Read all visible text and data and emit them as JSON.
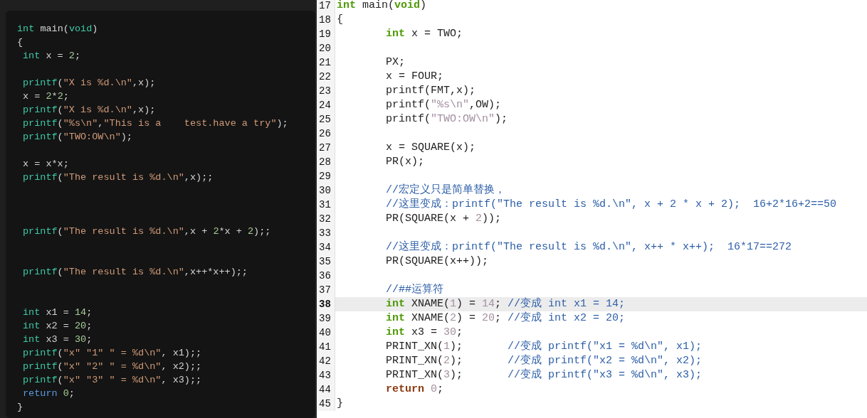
{
  "left_code": {
    "lines": [
      {
        "kind": "code",
        "segments": [
          {
            "text": "int",
            "kind": "keyword"
          },
          {
            "text": " main(",
            "kind": "plain"
          },
          {
            "text": "void",
            "kind": "keyword"
          },
          {
            "text": ")",
            "kind": "plain"
          }
        ]
      },
      {
        "kind": "code",
        "segments": [
          {
            "text": "{",
            "kind": "plain"
          }
        ],
        "children": [
          {
            "kind": "code",
            "segments": [
              {
                "text": "int",
                "kind": "keyword"
              },
              {
                "text": " x = ",
                "kind": "plain"
              },
              {
                "text": "2",
                "kind": "number"
              },
              {
                "text": ";",
                "kind": "plain"
              }
            ]
          },
          {
            "kind": "blank"
          },
          {
            "kind": "code",
            "segments": [
              {
                "text": "printf",
                "kind": "keyword"
              },
              {
                "text": "(",
                "kind": "plain"
              },
              {
                "text": "\"X is %d.\\n\"",
                "kind": "string"
              },
              {
                "text": ",x);",
                "kind": "plain"
              }
            ]
          },
          {
            "kind": "code",
            "segments": [
              {
                "text": "x = ",
                "kind": "plain"
              },
              {
                "text": "2",
                "kind": "number"
              },
              {
                "text": "*",
                "kind": "plain"
              },
              {
                "text": "2",
                "kind": "number"
              },
              {
                "text": ";",
                "kind": "plain"
              }
            ]
          },
          {
            "kind": "code",
            "segments": [
              {
                "text": "printf",
                "kind": "keyword"
              },
              {
                "text": "(",
                "kind": "plain"
              },
              {
                "text": "\"X is %d.\\n\"",
                "kind": "string"
              },
              {
                "text": ",x);",
                "kind": "plain"
              }
            ]
          },
          {
            "kind": "code",
            "segments": [
              {
                "text": "printf",
                "kind": "keyword"
              },
              {
                "text": "(",
                "kind": "plain"
              },
              {
                "text": "\"%s\\n\"",
                "kind": "string"
              },
              {
                "text": ",",
                "kind": "plain"
              },
              {
                "text": "\"This is a    test.have a try\"",
                "kind": "string"
              },
              {
                "text": ");",
                "kind": "plain"
              }
            ]
          },
          {
            "kind": "code",
            "segments": [
              {
                "text": "printf",
                "kind": "keyword"
              },
              {
                "text": "(",
                "kind": "plain"
              },
              {
                "text": "\"TWO:OW\\n\"",
                "kind": "string"
              },
              {
                "text": ");",
                "kind": "plain"
              }
            ]
          },
          {
            "kind": "blank"
          },
          {
            "kind": "code",
            "segments": [
              {
                "text": "x = x*x;",
                "kind": "plain"
              }
            ]
          },
          {
            "kind": "code",
            "segments": [
              {
                "text": "printf",
                "kind": "keyword"
              },
              {
                "text": "(",
                "kind": "plain"
              },
              {
                "text": "\"The result is %d.\\n\"",
                "kind": "string"
              },
              {
                "text": ",x);;",
                "kind": "plain"
              }
            ]
          },
          {
            "kind": "blank"
          },
          {
            "kind": "blank"
          },
          {
            "kind": "blank"
          },
          {
            "kind": "code",
            "segments": [
              {
                "text": "printf",
                "kind": "keyword"
              },
              {
                "text": "(",
                "kind": "plain"
              },
              {
                "text": "\"The result is %d.\\n\"",
                "kind": "string"
              },
              {
                "text": ",x + ",
                "kind": "plain"
              },
              {
                "text": "2",
                "kind": "number"
              },
              {
                "text": "*x + ",
                "kind": "plain"
              },
              {
                "text": "2",
                "kind": "number"
              },
              {
                "text": ");;",
                "kind": "plain"
              }
            ]
          },
          {
            "kind": "blank"
          },
          {
            "kind": "blank"
          },
          {
            "kind": "code",
            "segments": [
              {
                "text": "printf",
                "kind": "keyword"
              },
              {
                "text": "(",
                "kind": "plain"
              },
              {
                "text": "\"The result is %d.\\n\"",
                "kind": "string"
              },
              {
                "text": ",x++*x++);;",
                "kind": "plain"
              }
            ]
          },
          {
            "kind": "blank"
          },
          {
            "kind": "blank"
          },
          {
            "kind": "code",
            "segments": [
              {
                "text": "int",
                "kind": "keyword"
              },
              {
                "text": " x1 = ",
                "kind": "plain"
              },
              {
                "text": "14",
                "kind": "number"
              },
              {
                "text": ";",
                "kind": "plain"
              }
            ]
          },
          {
            "kind": "code",
            "segments": [
              {
                "text": "int",
                "kind": "keyword"
              },
              {
                "text": " x2 = ",
                "kind": "plain"
              },
              {
                "text": "20",
                "kind": "number"
              },
              {
                "text": ";",
                "kind": "plain"
              }
            ]
          },
          {
            "kind": "code",
            "segments": [
              {
                "text": "int",
                "kind": "keyword"
              },
              {
                "text": " x3 = ",
                "kind": "plain"
              },
              {
                "text": "30",
                "kind": "number"
              },
              {
                "text": ";",
                "kind": "plain"
              }
            ]
          },
          {
            "kind": "code",
            "segments": [
              {
                "text": "printf",
                "kind": "keyword"
              },
              {
                "text": "(",
                "kind": "plain"
              },
              {
                "text": "\"x\" \"1\" \" = %d\\n\"",
                "kind": "string"
              },
              {
                "text": ", x1);;",
                "kind": "plain"
              }
            ]
          },
          {
            "kind": "code",
            "segments": [
              {
                "text": "printf",
                "kind": "keyword"
              },
              {
                "text": "(",
                "kind": "plain"
              },
              {
                "text": "\"x\" \"2\" \" = %d\\n\"",
                "kind": "string"
              },
              {
                "text": ", x2);;",
                "kind": "plain"
              }
            ]
          },
          {
            "kind": "code",
            "segments": [
              {
                "text": "printf",
                "kind": "keyword"
              },
              {
                "text": "(",
                "kind": "plain"
              },
              {
                "text": "\"x\" \"3\" \" = %d\\n\"",
                "kind": "string"
              },
              {
                "text": ", x3);;",
                "kind": "plain"
              }
            ]
          },
          {
            "kind": "code",
            "segments": [
              {
                "text": "return ",
                "kind": "return"
              },
              {
                "text": "0",
                "kind": "number"
              },
              {
                "text": ";",
                "kind": "plain"
              }
            ]
          }
        ]
      },
      {
        "kind": "code",
        "segments": [
          {
            "text": "}",
            "kind": "plain"
          }
        ]
      }
    ]
  },
  "right_code": {
    "lines": [
      {
        "number": "17",
        "current": false,
        "segments": [
          {
            "text": "int",
            "kind": "keyword"
          },
          {
            "text": " main(",
            "kind": "plain"
          },
          {
            "text": "void",
            "kind": "keyword"
          },
          {
            "text": ")",
            "kind": "plain"
          }
        ]
      },
      {
        "number": "18",
        "current": false,
        "segments": [
          {
            "text": "{",
            "kind": "plain"
          }
        ],
        "children": [
          {
            "number": "19",
            "current": false,
            "segments": [
              {
                "text": "int",
                "kind": "keyword"
              },
              {
                "text": " x = TWO;",
                "kind": "plain"
              }
            ]
          },
          {
            "number": "20",
            "current": false
          },
          {
            "number": "21",
            "current": false,
            "segments": [
              {
                "text": "PX;",
                "kind": "plain"
              }
            ]
          },
          {
            "number": "22",
            "current": false,
            "segments": [
              {
                "text": "x = FOUR;",
                "kind": "plain"
              }
            ]
          },
          {
            "number": "23",
            "current": false,
            "segments": [
              {
                "text": "printf(FMT,x);",
                "kind": "plain"
              }
            ]
          },
          {
            "number": "24",
            "current": false,
            "segments": [
              {
                "text": "printf(",
                "kind": "plain"
              },
              {
                "text": "\"%s\\n\"",
                "kind": "string"
              },
              {
                "text": ",OW);",
                "kind": "plain"
              }
            ]
          },
          {
            "number": "25",
            "current": false,
            "segments": [
              {
                "text": "printf(",
                "kind": "plain"
              },
              {
                "text": "\"TWO:OW\\n\"",
                "kind": "string"
              },
              {
                "text": ");",
                "kind": "plain"
              }
            ]
          },
          {
            "number": "26",
            "current": false
          },
          {
            "number": "27",
            "current": false,
            "segments": [
              {
                "text": "x = SQUARE(x);",
                "kind": "plain"
              }
            ]
          },
          {
            "number": "28",
            "current": false,
            "segments": [
              {
                "text": "PR(x);",
                "kind": "plain"
              }
            ]
          },
          {
            "number": "29",
            "current": false
          },
          {
            "number": "30",
            "current": false,
            "segments": [
              {
                "text": "//宏定义只是简单替换，",
                "kind": "comment"
              }
            ]
          },
          {
            "number": "31",
            "current": false,
            "segments": [
              {
                "text": "//这里变成：printf(\"The result is %d.\\n\", x + 2 * x + 2);  16+2*16+2==50",
                "kind": "comment"
              }
            ]
          },
          {
            "number": "32",
            "current": false,
            "segments": [
              {
                "text": "PR(SQUARE(x + ",
                "kind": "plain"
              },
              {
                "text": "2",
                "kind": "number"
              },
              {
                "text": "));",
                "kind": "plain"
              }
            ]
          },
          {
            "number": "33",
            "current": false
          },
          {
            "number": "34",
            "current": false,
            "segments": [
              {
                "text": "//这里变成：printf(\"The result is %d.\\n\", x++ * x++);  16*17==272",
                "kind": "comment"
              }
            ]
          },
          {
            "number": "35",
            "current": false,
            "segments": [
              {
                "text": "PR(SQUARE(x++));",
                "kind": "plain"
              }
            ]
          },
          {
            "number": "36",
            "current": false
          },
          {
            "number": "37",
            "current": false,
            "segments": [
              {
                "text": "//##运算符",
                "kind": "comment"
              }
            ]
          },
          {
            "number": "38",
            "current": true,
            "segments": [
              {
                "text": "int",
                "kind": "keyword"
              },
              {
                "text": " XNAME(",
                "kind": "plain"
              },
              {
                "text": "1",
                "kind": "number"
              },
              {
                "text": ") = ",
                "kind": "plain"
              },
              {
                "text": "14",
                "kind": "number"
              },
              {
                "text": "; ",
                "kind": "plain"
              },
              {
                "text": "//变成 int x1 = 14;",
                "kind": "comment"
              }
            ]
          },
          {
            "number": "39",
            "current": false,
            "segments": [
              {
                "text": "int",
                "kind": "keyword"
              },
              {
                "text": " XNAME(",
                "kind": "plain"
              },
              {
                "text": "2",
                "kind": "number"
              },
              {
                "text": ") = ",
                "kind": "plain"
              },
              {
                "text": "20",
                "kind": "number"
              },
              {
                "text": "; ",
                "kind": "plain"
              },
              {
                "text": "//变成 int x2 = 20;",
                "kind": "comment"
              }
            ]
          },
          {
            "number": "40",
            "current": false,
            "segments": [
              {
                "text": "int",
                "kind": "keyword"
              },
              {
                "text": " x3 = ",
                "kind": "plain"
              },
              {
                "text": "30",
                "kind": "number"
              },
              {
                "text": ";",
                "kind": "plain"
              }
            ]
          },
          {
            "number": "41",
            "current": false,
            "segments": [
              {
                "text": "PRINT_XN(",
                "kind": "plain"
              },
              {
                "text": "1",
                "kind": "number"
              },
              {
                "text": ");       ",
                "kind": "plain"
              },
              {
                "text": "//变成 printf(\"x1 = %d\\n\", x1);",
                "kind": "comment"
              }
            ]
          },
          {
            "number": "42",
            "current": false,
            "segments": [
              {
                "text": "PRINT_XN(",
                "kind": "plain"
              },
              {
                "text": "2",
                "kind": "number"
              },
              {
                "text": ");       ",
                "kind": "plain"
              },
              {
                "text": "//变成 printf(\"x2 = %d\\n\", x2);",
                "kind": "comment"
              }
            ]
          },
          {
            "number": "43",
            "current": false,
            "segments": [
              {
                "text": "PRINT_XN(",
                "kind": "plain"
              },
              {
                "text": "3",
                "kind": "number"
              },
              {
                "text": ");       ",
                "kind": "plain"
              },
              {
                "text": "//变成 printf(\"x3 = %d\\n\", x3);",
                "kind": "comment"
              }
            ]
          },
          {
            "number": "44",
            "current": false,
            "segments": [
              {
                "text": "return ",
                "kind": "return"
              },
              {
                "text": "0",
                "kind": "number"
              },
              {
                "text": ";",
                "kind": "plain"
              }
            ]
          }
        ]
      },
      {
        "number": "45",
        "current": false,
        "segments": [
          {
            "text": "}",
            "kind": "plain"
          }
        ]
      }
    ]
  }
}
